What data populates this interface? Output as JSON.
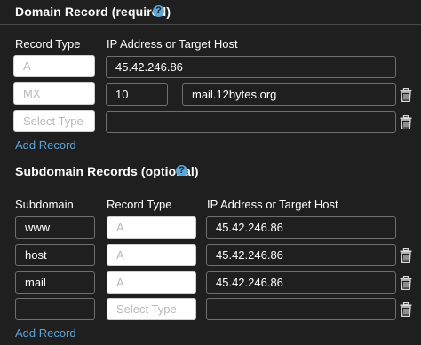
{
  "domain": {
    "title": "Domain Record (required)",
    "help_glyph": "?",
    "col_type": "Record Type",
    "col_target": "IP Address or Target Host",
    "rows": [
      {
        "type": "A",
        "value": "45.42.246.86"
      },
      {
        "type": "MX",
        "priority": "10",
        "value": "mail.12bytes.org"
      },
      {
        "type_placeholder": "Select Type",
        "value": ""
      }
    ],
    "add_label": "Add Record"
  },
  "subdomain": {
    "title": "Subdomain Records (optional)",
    "help_glyph": "?",
    "col_sub": "Subdomain",
    "col_type": "Record Type",
    "col_target": "IP Address or Target Host",
    "rows": [
      {
        "name": "www",
        "type": "A",
        "value": "45.42.246.86"
      },
      {
        "name": "host",
        "type": "A",
        "value": "45.42.246.86"
      },
      {
        "name": "mail",
        "type": "A",
        "value": "45.42.246.86"
      },
      {
        "name": "",
        "type_placeholder": "Select Type",
        "value": ""
      }
    ],
    "add_label": "Add Record"
  },
  "colors": {
    "background": "#1f1f1f",
    "accent": "#5ba5d8",
    "field_border": "#6f6f6f"
  },
  "icons": {
    "help": "help-icon",
    "delete": "trash-icon"
  }
}
